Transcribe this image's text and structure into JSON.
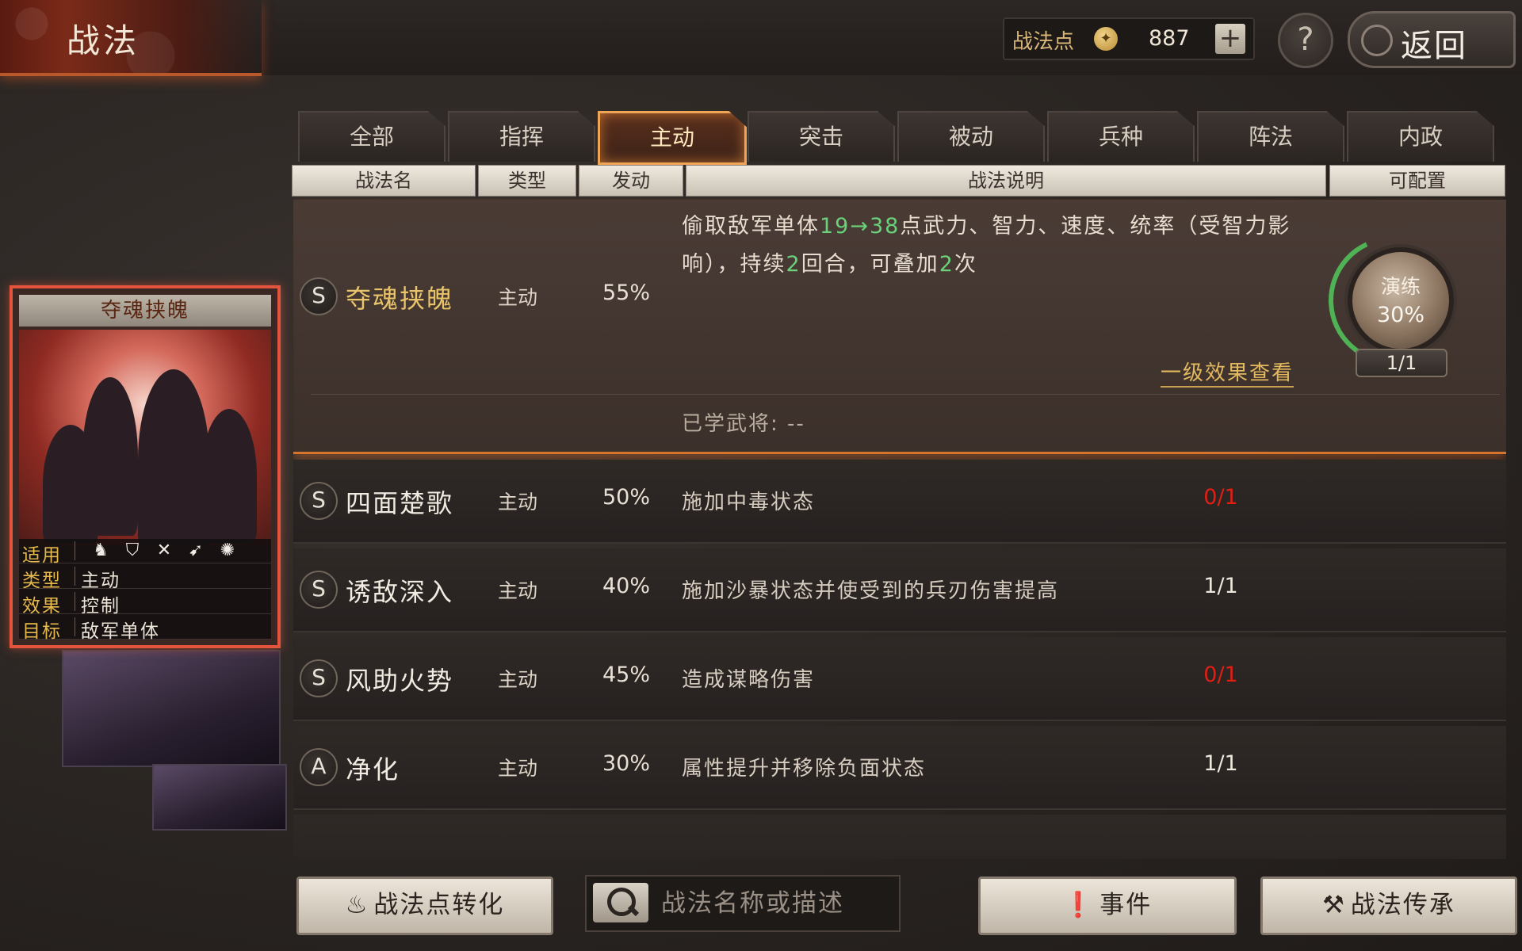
{
  "header": {
    "title": "战法",
    "points_label": "战法点",
    "points_value": "887",
    "help": "?",
    "back": "返回"
  },
  "tabs": [
    "全部",
    "指挥",
    "主动",
    "突击",
    "被动",
    "兵种",
    "阵法",
    "内政"
  ],
  "active_tab": "主动",
  "columns": [
    "战法名",
    "类型",
    "发动",
    "战法说明",
    "可配置"
  ],
  "expanded": {
    "grade": "S",
    "name": "夺魂挟魄",
    "type": "主动",
    "rate": "55%",
    "desc_prefix": "偷取敌军单体",
    "desc_hi1": "19→38",
    "desc_mid": "点武力、智力、速度、统率（受智力影响），持续",
    "desc_hi2": "2",
    "desc_mid2": "回合，可叠加",
    "desc_hi3": "2",
    "desc_suffix": "次",
    "level_link": "一级效果查看",
    "learned_label": "已学武将:",
    "learned_value": "--",
    "practice_label": "演练",
    "practice_value": "30%",
    "practice_progress": 0.3,
    "count": "1/1"
  },
  "rows": [
    {
      "grade": "S",
      "name": "四面楚歌",
      "type": "主动",
      "rate": "50%",
      "desc": "施加中毒状态",
      "count": "0/1",
      "count_color": "#e01f14"
    },
    {
      "grade": "S",
      "name": "诱敌深入",
      "type": "主动",
      "rate": "40%",
      "desc": "施加沙暴状态并使受到的兵刃伤害提高",
      "count": "1/1",
      "count_color": "#ece6dc"
    },
    {
      "grade": "S",
      "name": "风助火势",
      "type": "主动",
      "rate": "45%",
      "desc": "造成谋略伤害",
      "count": "0/1",
      "count_color": "#e01f14"
    },
    {
      "grade": "A",
      "name": "净化",
      "type": "主动",
      "rate": "30%",
      "desc": "属性提升并移除负面状态",
      "count": "1/1",
      "count_color": "#ece6dc"
    }
  ],
  "card": {
    "name": "夺魂挟魄",
    "apply_label": "适用",
    "type_label": "类型",
    "type_value": "主动",
    "effect_label": "效果",
    "effect_value": "控制",
    "target_label": "目标",
    "target_value": "敌军单体",
    "unit_icons": [
      "cavalry-icon",
      "shield-icon",
      "archer-icon",
      "spear-icon",
      "wheel-icon"
    ]
  },
  "bottom": {
    "convert": "战法点转化",
    "search_placeholder": "战法名称或描述",
    "events": "事件",
    "inherit": "战法传承"
  }
}
